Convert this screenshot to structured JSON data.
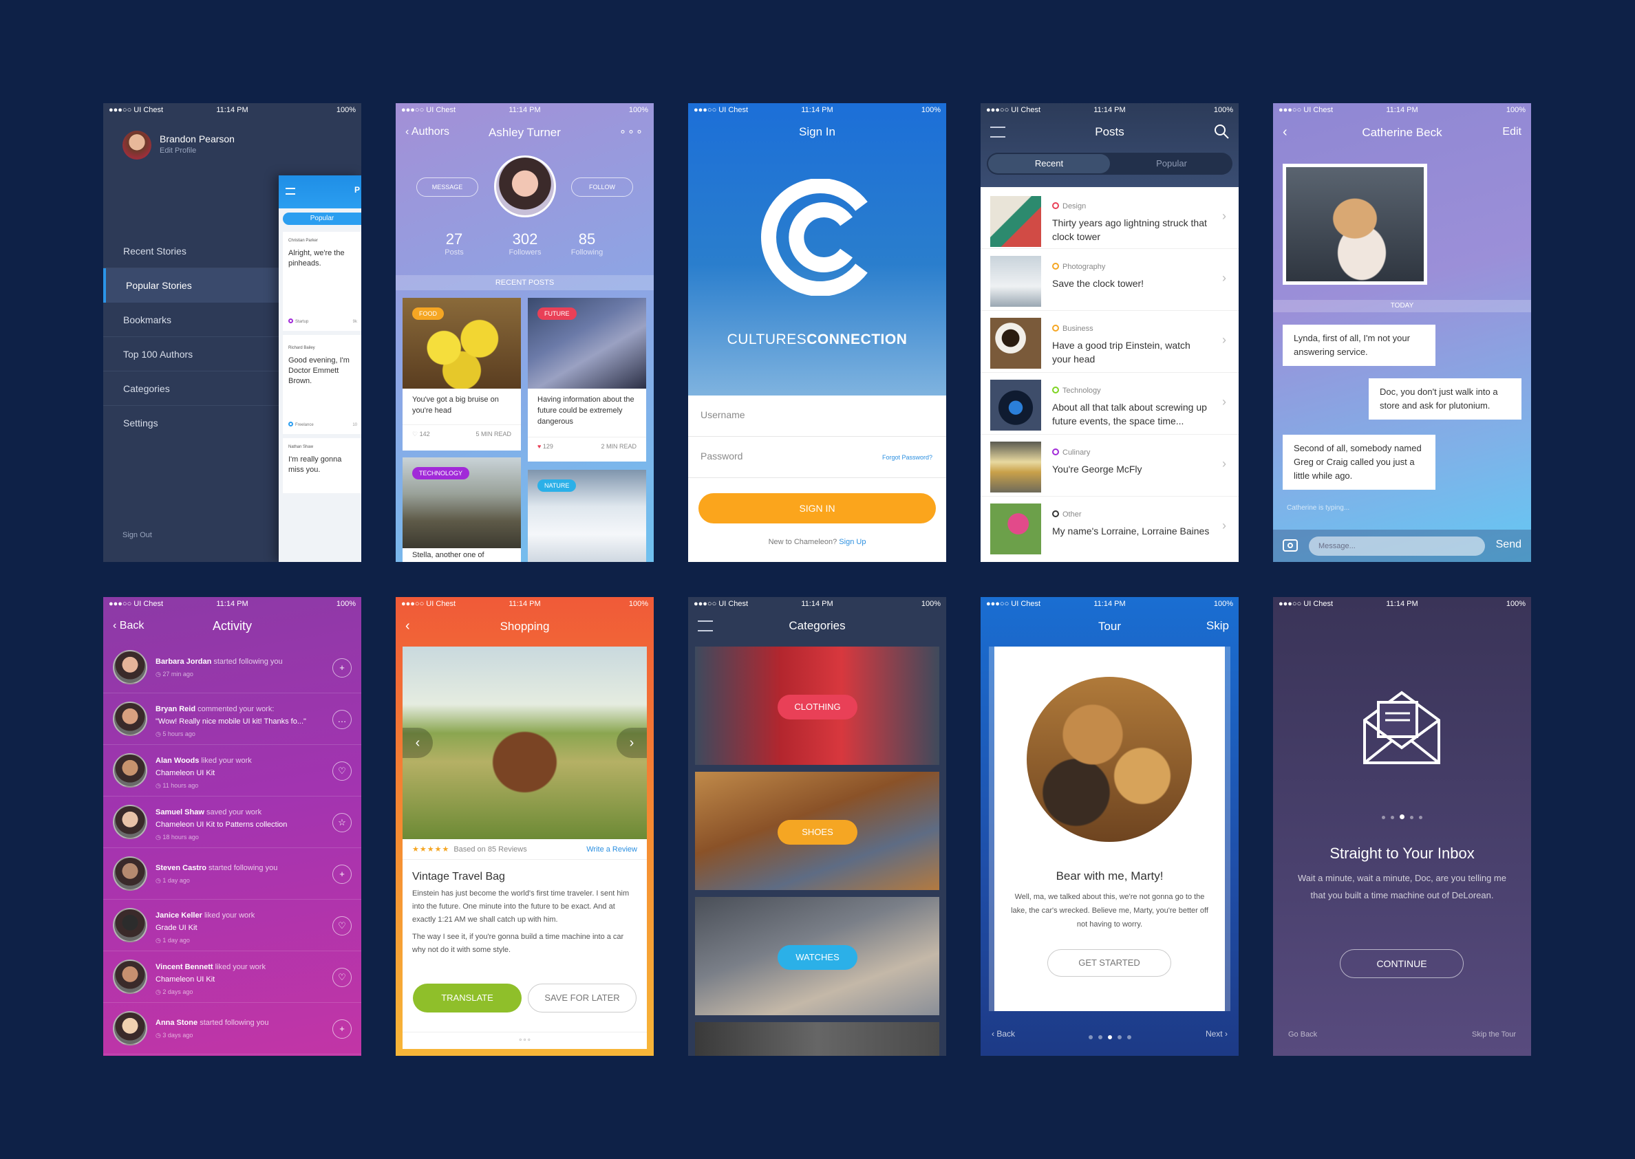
{
  "status": {
    "carrier": "●●●○○ UI Chest",
    "time": "11:14 PM",
    "battery": "100%"
  },
  "menu": {
    "user": "Brandon Pearson",
    "edit": "Edit Profile",
    "items": [
      "Recent Stories",
      "Popular Stories",
      "Bookmarks",
      "Top 100 Authors",
      "Categories",
      "Settings"
    ],
    "signout": "Sign Out",
    "overlay": {
      "title": "P",
      "tab": "Popular",
      "cards": [
        {
          "name": "Christian Parker",
          "text": "Alright, we're the pinheads.",
          "tag": "Startup",
          "count": "9k"
        },
        {
          "name": "Richard Bailey",
          "text": "Good evening, I'm Doctor Emmett Brown.",
          "tag": "Freelance",
          "count": "10"
        },
        {
          "name": "Nathan Shaw",
          "text": "I'm really gonna miss you."
        }
      ]
    }
  },
  "profile": {
    "back": "Authors",
    "name": "Ashley Turner",
    "message": "MESSAGE",
    "follow": "FOLLOW",
    "stats": [
      {
        "n": "27",
        "l": "Posts"
      },
      {
        "n": "302",
        "l": "Followers"
      },
      {
        "n": "85",
        "l": "Following"
      }
    ],
    "recent": "RECENT POSTS",
    "cards": [
      {
        "tag": "FOOD",
        "text": "You've got a big bruise on you're head",
        "likes": "142",
        "read": "5 MIN READ",
        "tagcolor": "#f5a623"
      },
      {
        "tag": "FUTURE",
        "text": "Having information about the future could be extremely dangerous",
        "likes": "129",
        "read": "2 MIN READ",
        "tagcolor": "#e94057"
      },
      {
        "tag": "TECHNOLOGY",
        "text": "Stella, another one of",
        "tagcolor": "#a12ad8"
      },
      {
        "tag": "NATURE",
        "tagcolor": "#2bb0e8"
      }
    ]
  },
  "signin": {
    "title": "Sign In",
    "brand_a": "CULTURES",
    "brand_b": "CONNECTION",
    "username": "Username",
    "password": "Password",
    "forgot": "Forgot Password?",
    "button": "SIGN IN",
    "new": "New to Chameleon?",
    "signup": "Sign Up"
  },
  "posts": {
    "title": "Posts",
    "tabs": [
      "Recent",
      "Popular"
    ],
    "items": [
      {
        "cat": "Design",
        "text": "Thirty years ago lightning struck that clock tower",
        "color": "#e94057"
      },
      {
        "cat": "Photography",
        "text": "Save the clock tower!",
        "color": "#f5a623"
      },
      {
        "cat": "Business",
        "text": "Have a good trip Einstein, watch your head",
        "color": "#f5a623"
      },
      {
        "cat": "Technology",
        "text": "About all that talk about screwing up future events, the space time...",
        "color": "#7ed321"
      },
      {
        "cat": "Culinary",
        "text": "You're George McFly",
        "color": "#a12ad8"
      },
      {
        "cat": "Other",
        "text": "My name's Lorraine, Lorraine Baines",
        "color": "#333333"
      }
    ]
  },
  "chat": {
    "name": "Catherine Beck",
    "edit": "Edit",
    "today": "TODAY",
    "messages": [
      {
        "text": "Lynda, first of all, I'm not your answering service.",
        "side": "left"
      },
      {
        "text": "Doc, you don't just walk into a store and ask for plutonium.",
        "side": "right"
      },
      {
        "text": "Second of all, somebody named Greg or Craig called you just a little while ago.",
        "side": "left"
      }
    ],
    "typing": "Catherine is typing...",
    "placeholder": "Message...",
    "send": "Send"
  },
  "activity": {
    "back": "Back",
    "title": "Activity",
    "items": [
      {
        "name": "Barbara Jordan",
        "action": "started following you",
        "time": "27 min ago",
        "btn": "+"
      },
      {
        "name": "Bryan Reid",
        "action": "commented your work:",
        "detail": "\"Wow! Really nice mobile UI kit! Thanks fo...\"",
        "time": "5 hours ago",
        "btn": "…"
      },
      {
        "name": "Alan Woods",
        "action": "liked your work",
        "detail": "Chameleon UI Kit",
        "time": "11 hours ago",
        "btn": "♡"
      },
      {
        "name": "Samuel Shaw",
        "action": "saved your work",
        "detail": "Chameleon UI Kit  to  Patterns collection",
        "time": "18 hours ago",
        "btn": "☆"
      },
      {
        "name": "Steven Castro",
        "action": "started following you",
        "time": "1 day ago",
        "btn": "+"
      },
      {
        "name": "Janice Keller",
        "action": "liked your work",
        "detail": "Grade UI Kit",
        "time": "1 day ago",
        "btn": "♡"
      },
      {
        "name": "Vincent Bennett",
        "action": "liked your work",
        "detail": "Chameleon UI Kit",
        "time": "2 days ago",
        "btn": "♡"
      },
      {
        "name": "Anna Stone",
        "action": "started following you",
        "time": "3 days ago",
        "btn": "+"
      }
    ]
  },
  "shopping": {
    "title": "Shopping",
    "rating": 4.5,
    "reviews": "Based on 85 Reviews",
    "write": "Write a Review",
    "product": "Vintage Travel Bag",
    "p1": "Einstein has just become the world's first time traveler. I sent him into the future. One minute into the future to be exact. And at exactly 1:21 AM we shall catch up with him.",
    "p2": "The way I see it, if you're gonna build a time machine into a car why not do it with some style.",
    "translate": "TRANSLATE",
    "save": "SAVE FOR LATER"
  },
  "categories": {
    "title": "Categories",
    "items": [
      {
        "label": "CLOTHING",
        "color": "#e94057"
      },
      {
        "label": "SHOES",
        "color": "#f5a623"
      },
      {
        "label": "WATCHES",
        "color": "#2bb0e8"
      }
    ]
  },
  "tour": {
    "title": "Tour",
    "skip": "Skip",
    "heading": "Bear with me, Marty!",
    "body": "Well, ma, we talked about this, we're not gonna go to the lake, the car's wrecked. Believe me, Marty, you're better off not having to worry.",
    "button": "GET STARTED",
    "back": "Back",
    "next": "Next"
  },
  "inbox": {
    "heading": "Straight to Your Inbox",
    "body": "Wait a minute, wait a minute, Doc, are you telling me that you built a time machine out of DeLorean.",
    "button": "CONTINUE",
    "goback": "Go Back",
    "skip": "Skip the Tour"
  }
}
